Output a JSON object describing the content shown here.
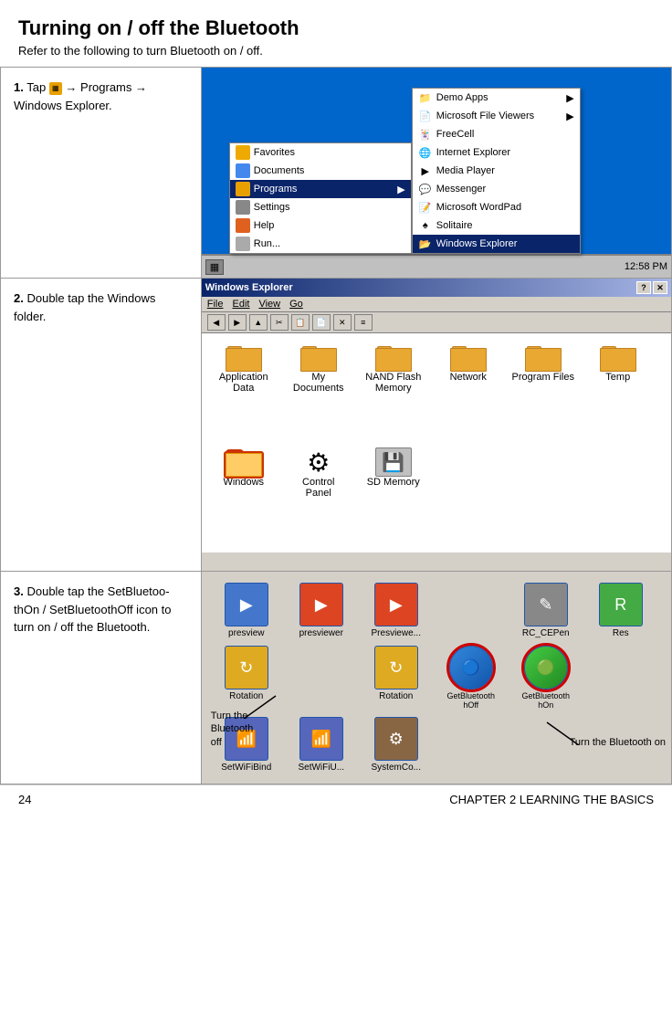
{
  "page": {
    "title": "Turning on / off the Bluetooth",
    "subtitle": "Refer to the following to turn Bluetooth on / off."
  },
  "steps": [
    {
      "number": "1.",
      "instruction": "Tap  → Programs → Windows Explorer.",
      "screen": {
        "menu_items": [
          "Favorites",
          "Documents",
          "Settings",
          "Help",
          "Run..."
        ],
        "programs_items": [
          "Demo Apps",
          "Microsoft File Viewers",
          "FreeCell",
          "Internet Explorer",
          "Media Player",
          "Messenger",
          "Microsoft WordPad",
          "Solitaire",
          "Windows Explorer"
        ],
        "highlighted": "Programs",
        "windows_explorer_highlighted": true,
        "taskbar_time": "12:58 PM"
      }
    },
    {
      "number": "2.",
      "instruction": "Double tap the Windows folder.",
      "screen": {
        "window_title": "Windows Explorer",
        "menu": [
          "File",
          "Edit",
          "View",
          "Go"
        ],
        "folders": [
          {
            "name": "Application\nData",
            "type": "folder"
          },
          {
            "name": "My\nDocuments",
            "type": "folder"
          },
          {
            "name": "NAND Flash\nMemory",
            "type": "folder"
          },
          {
            "name": "Network",
            "type": "folder"
          },
          {
            "name": "Program Files",
            "type": "folder"
          },
          {
            "name": "Temp",
            "type": "folder"
          },
          {
            "name": "Windows",
            "type": "folder",
            "selected": true
          },
          {
            "name": "Control\nPanel",
            "type": "control"
          },
          {
            "name": "SD Memory",
            "type": "sd"
          }
        ]
      }
    },
    {
      "number": "3.",
      "instruction": "Double tap the SetBluetoo-thOn / SetBluetoothOff icon to turn on / off the Bluetooth.",
      "screen": {
        "icons": [
          {
            "name": "presview",
            "color": "#5599cc"
          },
          {
            "name": "presviewer",
            "color": "#dd4422"
          },
          {
            "name": "Presviewe...",
            "color": "#dd4422"
          },
          {
            "name": "RC_CEPen",
            "color": "#888888"
          },
          {
            "name": "Res",
            "color": "#44aa44"
          },
          {
            "name": "Rotation",
            "color": "#ddaa22"
          },
          {
            "name": "Rotation",
            "color": "#ddaa22"
          },
          {
            "name": "GetBluetooth\nhOff",
            "color": "#3388dd",
            "highlight": true
          },
          {
            "name": "GetBluetooth\nhOn",
            "color": "#44aa44",
            "highlight": true
          },
          {
            "name": "SetWiFiBind",
            "color": "#5566bb"
          },
          {
            "name": "SetWiFiU...",
            "color": "#5566bb"
          },
          {
            "name": "SystemCo...",
            "color": "#886644"
          }
        ],
        "callout_left": "Turn the\nBluetooth\noff",
        "callout_right": "Turn the\nBluetooth on"
      }
    }
  ],
  "footer": {
    "page_number": "24",
    "chapter": "CHAPTER 2  LEARNING THE BASICS"
  }
}
